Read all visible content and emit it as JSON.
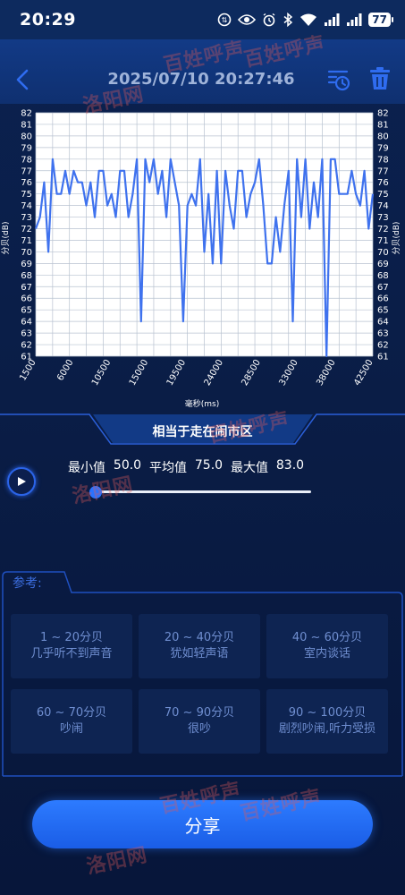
{
  "status_bar": {
    "time": "20:29",
    "battery": "77"
  },
  "header": {
    "title": "2025/07/10 20:27:46"
  },
  "chart_data": {
    "type": "line",
    "xlabel": "毫秒(ms)",
    "ylabel": "分贝(dB)",
    "ylim": [
      61,
      82
    ],
    "xlim": [
      1500,
      42500
    ],
    "x_ticks": [
      "1500",
      "6000",
      "10500",
      "15000",
      "19500",
      "24000",
      "28500",
      "33000",
      "38000",
      "42500"
    ],
    "y_ticks": [
      "82",
      "81",
      "80",
      "79",
      "78",
      "77",
      "76",
      "75",
      "74",
      "73",
      "72",
      "71",
      "70",
      "69",
      "68",
      "67",
      "66",
      "65",
      "64",
      "63",
      "62",
      "61"
    ],
    "grid": true,
    "series": [
      {
        "values": [
          72,
          73,
          76,
          70,
          78,
          75,
          75,
          77,
          75,
          77,
          76,
          76,
          74,
          76,
          73,
          77,
          77,
          74,
          75,
          73,
          77,
          77,
          73,
          75,
          78,
          64,
          78,
          76,
          78,
          75,
          77,
          73,
          78,
          76,
          74,
          64,
          74,
          75,
          74,
          78,
          70,
          75,
          69,
          77,
          69,
          77,
          74,
          72,
          77,
          77,
          73,
          75,
          76,
          78,
          74,
          69,
          69,
          73,
          70,
          74,
          77,
          64,
          78,
          73,
          78,
          72,
          76,
          73,
          78,
          61,
          78,
          78,
          75,
          75,
          75,
          77,
          75,
          74,
          77,
          72,
          75
        ]
      }
    ],
    "line_color": "#3f72ee"
  },
  "scene": {
    "label": "相当于走在闹市区"
  },
  "stats": {
    "min_label": "最小值",
    "min_value": "50.0",
    "avg_label": "平均值",
    "avg_value": "75.0",
    "max_label": "最大值",
    "max_value": "83.0"
  },
  "playback": {
    "progress": 0.0
  },
  "reference": {
    "title": "参考:",
    "items": [
      {
        "range": "1 ~ 20分贝",
        "desc": "几乎听不到声音"
      },
      {
        "range": "20 ~ 40分贝",
        "desc": "犹如轻声语"
      },
      {
        "range": "40 ~ 60分贝",
        "desc": "室内谈话"
      },
      {
        "range": "60 ~ 70分贝",
        "desc": "吵闹"
      },
      {
        "range": "70 ~ 90分贝",
        "desc": "很吵"
      },
      {
        "range": "90 ~ 100分贝",
        "desc": "剧烈吵闹,听力受损"
      }
    ]
  },
  "share_button": {
    "label": "分享"
  },
  "watermarks": [
    "百姓呼声",
    "百姓呼声",
    "洛阳网",
    "百姓呼声",
    "洛阳网",
    "百姓呼声",
    "洛阳网",
    "百姓呼声"
  ],
  "colors": {
    "background": "#0a1d46",
    "accent": "#2a72ff",
    "header_title": "#9fb3d9"
  }
}
